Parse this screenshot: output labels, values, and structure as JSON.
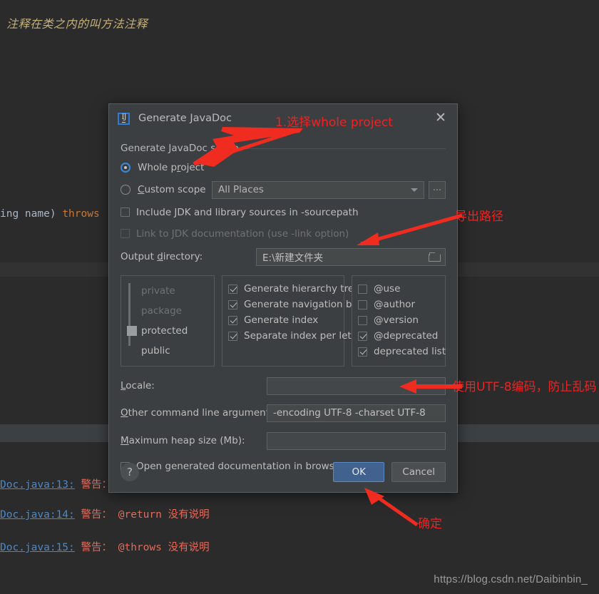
{
  "background": {
    "editor_note": "注释在类之内的叫方法注释",
    "code_line_prefix": "ing name) ",
    "code_line_keyword": "throws",
    "console": [
      {
        "link": "Doc.java:13:",
        "text": "警告："
      },
      {
        "link": "Doc.java:14:",
        "text": "警告： @return 没有说明"
      },
      {
        "link": "Doc.java:15:",
        "text": "警告： @throws 没有说明"
      }
    ],
    "watermark": "https://blog.csdn.net/Daibinbin_"
  },
  "annotations": [
    {
      "text": "1.选择whole project"
    },
    {
      "text": "导出路径"
    },
    {
      "text": "使用UTF-8编码，防止乱码"
    },
    {
      "text": "确定"
    }
  ],
  "dialog": {
    "icon": "intellij-idea-icon",
    "title": "Generate JavaDoc",
    "close_icon": "close-icon",
    "scope": {
      "group_label": "Generate JavaDoc scope",
      "whole_project": {
        "label": "Whole project",
        "selected": true
      },
      "custom_scope": {
        "label": "Custom scope",
        "selected": false
      },
      "scope_combo_value": "All Places",
      "browse_button": "...",
      "include_jdk": {
        "label": "Include JDK and library sources in -sourcepath",
        "checked": false
      },
      "link_jdk": {
        "label": "Link to JDK documentation (use -link option)",
        "checked": false,
        "disabled": true
      }
    },
    "output": {
      "label_pre": "Output ",
      "label_underline": "d",
      "label_post": "irectory:",
      "value": "E:\\新建文件夹",
      "folder_icon": "folder-icon"
    },
    "visibility": {
      "items": [
        {
          "label": "private",
          "active": false
        },
        {
          "label": "package",
          "active": false
        },
        {
          "label": "protected",
          "active": true
        },
        {
          "label": "public",
          "active": false
        }
      ]
    },
    "generate_options": [
      {
        "label": "Generate hierarchy tree",
        "checked": true
      },
      {
        "label": "Generate navigation bar",
        "checked": true
      },
      {
        "label": "Generate index",
        "checked": true
      },
      {
        "label": "Separate index per letter",
        "checked": true
      }
    ],
    "tag_options": [
      {
        "label": "@use",
        "checked": false
      },
      {
        "label": "@author",
        "checked": false
      },
      {
        "label": "@version",
        "checked": false
      },
      {
        "label": "@deprecated",
        "checked": true
      },
      {
        "label": "deprecated list",
        "checked": true
      }
    ],
    "fields": {
      "locale_label_pre": "",
      "locale_label_underline": "L",
      "locale_label_post": "ocale:",
      "locale_value": "",
      "args_label_underline": "O",
      "args_label_post": "ther command line arguments:",
      "args_value": "-encoding UTF-8 -charset UTF-8",
      "heap_label_underline": "M",
      "heap_label_post": "aximum heap size (Mb):",
      "heap_value": ""
    },
    "open_browser": {
      "label_pre": "Open ",
      "label_underline": "g",
      "label_post": "enerated documentation in browser",
      "checked": true
    },
    "footer": {
      "help_label": "?",
      "ok_label": "OK",
      "cancel_label": "Cancel"
    }
  },
  "colors": {
    "accent_blue": "#41628e",
    "annotation_red": "#ee2222",
    "dialog_bg": "#3c3f41",
    "editor_bg": "#2b2b2b",
    "note_yellow": "#c5b177"
  }
}
